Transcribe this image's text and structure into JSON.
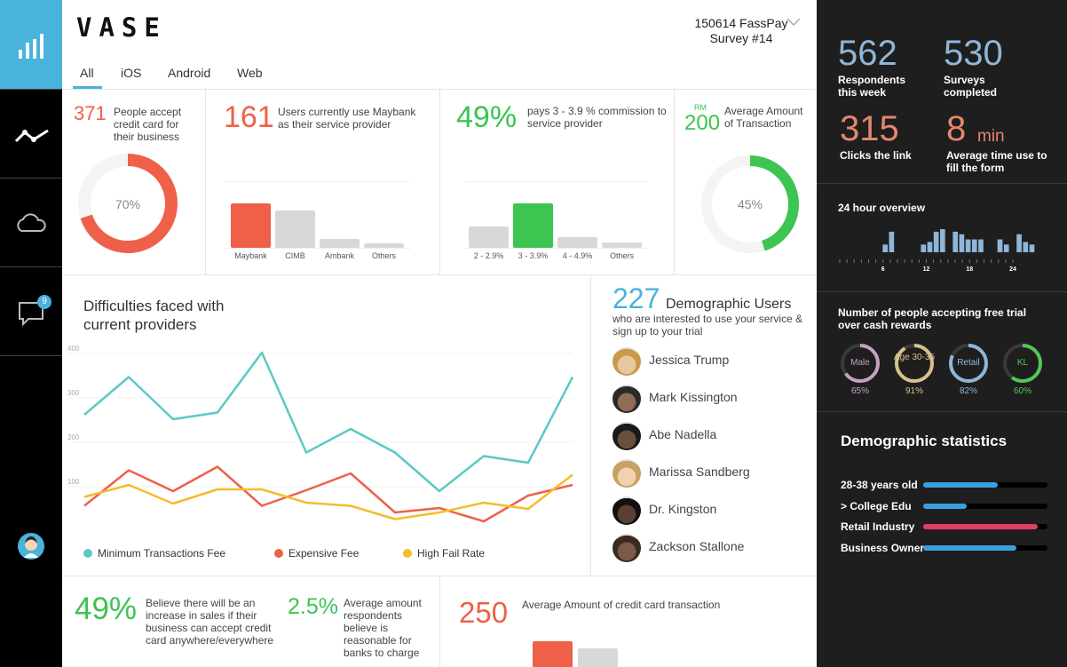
{
  "sidebar": {
    "items": [
      {
        "icon": "bar-chart-icon"
      },
      {
        "icon": "line-chart-icon"
      },
      {
        "icon": "cloud-icon"
      },
      {
        "icon": "chat-icon",
        "badge": "9"
      }
    ],
    "user": {
      "icon": "user-avatar-icon"
    }
  },
  "header": {
    "logo": "VASE",
    "survey_line1": "150614 FassPay",
    "survey_line2": "Survey #14",
    "tabs": [
      "All",
      "iOS",
      "Android",
      "Web"
    ],
    "active_tab": "All"
  },
  "cards": {
    "credit": {
      "number": "371",
      "text": "People accept credit card for their business",
      "percent_label": "70%",
      "percent": 0.7
    },
    "maybank": {
      "number": "161",
      "text": "Users currently use Maybank as their service provider",
      "categories": [
        "Maybank",
        "CIMB",
        "Ambank",
        "Others"
      ],
      "values": [
        50,
        42,
        10,
        5
      ]
    },
    "commission": {
      "number": "49%",
      "text": "pays 3 - 3.9 % commission to service provider",
      "categories": [
        "2 - 2.9%",
        "3 - 3.9%",
        "4 - 4.9%",
        "Others"
      ],
      "values": [
        20,
        42,
        10,
        5
      ]
    },
    "average": {
      "currency": "RM",
      "number": "200",
      "text": "Average Amount of Transaction",
      "percent_label": "45%",
      "percent": 0.45
    }
  },
  "difficulties": {
    "title_line1": "Difficulties faced with",
    "title_line2": "current providers"
  },
  "demographic": {
    "number": "227",
    "title": "Demographic Users",
    "subtitle": "who are interested to use your service & sign up to your trial",
    "people": [
      "Jessica Trump",
      "Mark Kissington",
      "Abe Nadella",
      "Marissa Sandberg",
      "Dr. Kingston",
      "Zackson Stallone"
    ]
  },
  "bottom": {
    "increase": {
      "number": "49%",
      "text": "Believe there will be an increase in sales if their business can accept credit card anywhere/everywhere"
    },
    "reasonable": {
      "number": "2.5%",
      "text": "Average amount respondents believe is reasonable for banks to charge"
    },
    "average_tx": {
      "number": "250",
      "text": "Average Amount of credit card transaction"
    }
  },
  "right": {
    "respondents": {
      "number": "562",
      "label": "Respondents this week"
    },
    "surveys": {
      "number": "530",
      "label": "Surveys completed"
    },
    "clicks": {
      "number": "315",
      "label": "Clicks the link"
    },
    "time": {
      "number": "8",
      "unit": "min",
      "label": "Average time use to fill the form"
    },
    "overview": {
      "title": "24 hour overview",
      "ticks": [
        "6",
        "12",
        "18",
        "24"
      ],
      "values": [
        0,
        0,
        0,
        0,
        0,
        0,
        0,
        3,
        8,
        0,
        0,
        0,
        0,
        3,
        4,
        8,
        9,
        0,
        8,
        7,
        5,
        5,
        5,
        0,
        0,
        5,
        3,
        0,
        7,
        4,
        3,
        0
      ]
    },
    "trial": {
      "title": "Number of people accepting free trial over cash rewards",
      "rings": [
        {
          "label": "Male",
          "percent_label": "65%",
          "percent": 0.65,
          "color": "#c99fc4"
        },
        {
          "label": "Age 30-35",
          "percent_label": "91%",
          "percent": 0.91,
          "color": "#d6c18b"
        },
        {
          "label": "Retail",
          "percent_label": "82%",
          "percent": 0.82,
          "color": "#8fb6d9"
        },
        {
          "label": "KL",
          "percent_label": "60%",
          "percent": 0.6,
          "color": "#54c658"
        }
      ]
    },
    "stats": {
      "title": "Demographic statistics",
      "rows": [
        {
          "label": "28-38 years old",
          "value": 0.6,
          "color": "#3a9fe0"
        },
        {
          "label": "> College Edu",
          "value": 0.35,
          "color": "#3a9fe0"
        },
        {
          "label": "Retail Industry",
          "value": 0.92,
          "color": "#e04060"
        },
        {
          "label": "Business Owner",
          "value": 0.75,
          "color": "#3a9fe0"
        }
      ]
    }
  },
  "colors": {
    "accent": "#4ab3dc",
    "red": "#ef6049",
    "green": "#3cc551",
    "teal": "#5cc9c3",
    "yellow": "#f4bd2a"
  },
  "chart_data": {
    "type": "line",
    "title": "Difficulties faced with current providers",
    "ylim": [
      0,
      400
    ],
    "yticks": [
      "100",
      "200",
      "300",
      "400"
    ],
    "x": [
      1,
      2,
      3,
      4,
      5,
      6,
      7,
      8,
      9,
      10,
      11,
      12
    ],
    "series": [
      {
        "name": "Minimum Transactions Fee",
        "color": "#5cc9c3",
        "values": [
          250,
          335,
          240,
          255,
          390,
          165,
          218,
          165,
          78,
          157,
          142,
          335
        ]
      },
      {
        "name": "Expensive Fee",
        "color": "#ef6049",
        "values": [
          45,
          125,
          78,
          133,
          45,
          80,
          118,
          30,
          40,
          10,
          68,
          92
        ]
      },
      {
        "name": "High Fail Rate",
        "color": "#f4bd2a",
        "values": [
          65,
          92,
          50,
          82,
          82,
          52,
          45,
          15,
          30,
          52,
          38,
          115
        ]
      }
    ],
    "legend": "bottom"
  }
}
